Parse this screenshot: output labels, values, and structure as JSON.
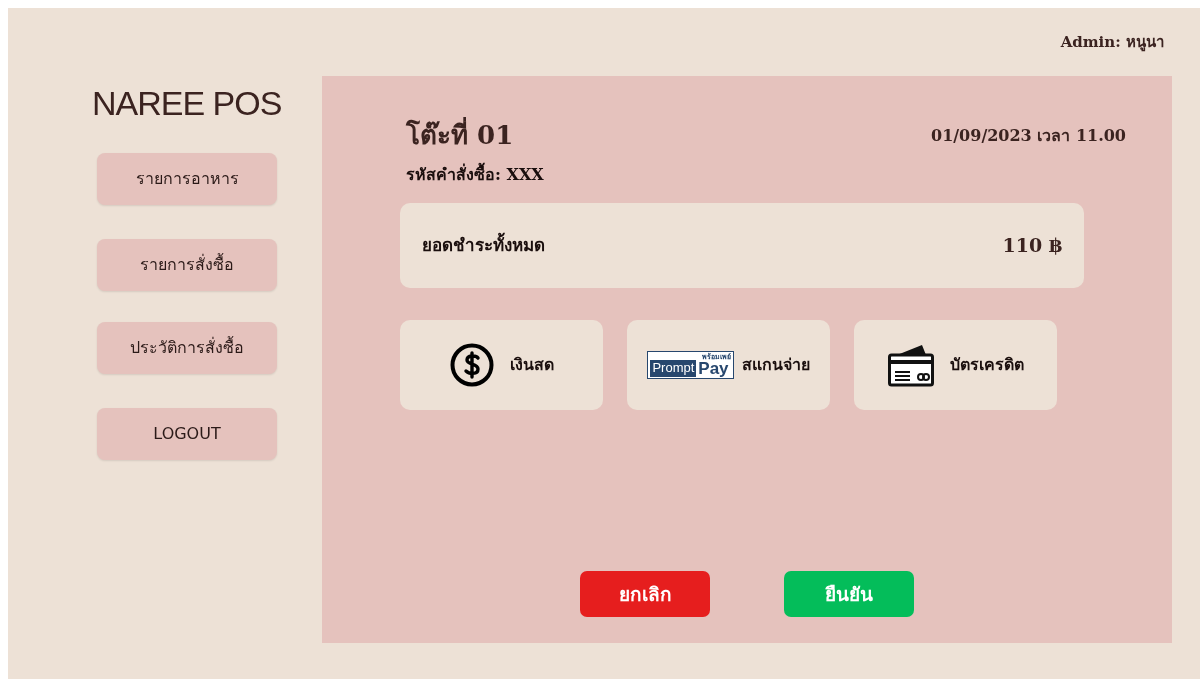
{
  "header": {
    "user": "Admin: หนูนา"
  },
  "sidebar": {
    "logo": "NAREE POS",
    "items": [
      {
        "label": "รายการอาหาร"
      },
      {
        "label": "รายการสั่งซื้อ"
      },
      {
        "label": "ประวัติการสั่งซื้อ"
      },
      {
        "label": "LOGOUT"
      }
    ]
  },
  "order": {
    "table": "โต๊ะที่ 01",
    "datetime": "01/09/2023 เวลา 11.00",
    "order_code": "รหัสคำสั่งซื้อ: XXX"
  },
  "total": {
    "label": "ยอดชำระทั้งหมด",
    "amount": "110 ฿"
  },
  "payment_methods": [
    {
      "kind": "cash",
      "label": "เงินสด"
    },
    {
      "kind": "promptpay",
      "label": "สแกนจ่าย",
      "logo_texts": [
        "พร้อมเพย์",
        "Prompt",
        "Pay"
      ]
    },
    {
      "kind": "card",
      "label": "บัตรเครดิต"
    }
  ],
  "buttons": [
    {
      "kind": "cancel",
      "label": "ยกเลิก"
    },
    {
      "kind": "confirm",
      "label": "ยืนยัน"
    }
  ]
}
